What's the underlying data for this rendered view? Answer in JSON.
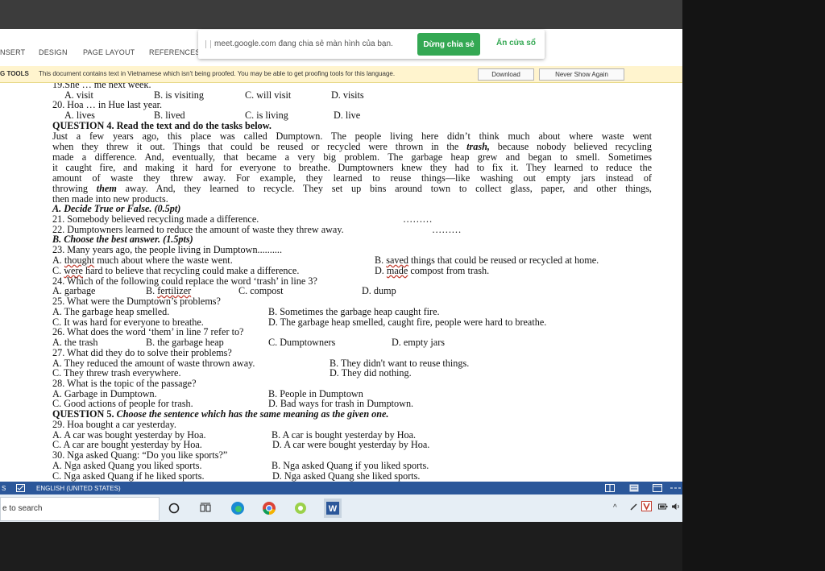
{
  "ribbon": {
    "tabs": [
      "NSERT",
      "DESIGN",
      "PAGE LAYOUT",
      "REFERENCES"
    ]
  },
  "share_bar": {
    "message": "meet.google.com đang chia sẻ màn hình của bạn.",
    "stop_button": "Dừng chia sẻ",
    "hide_button": "Ẩn cửa sổ"
  },
  "message_bar": {
    "label": "G TOOLS",
    "text": "This document contains text in Vietnamese which isn't being proofed. You may be able to get proofing tools for this language.",
    "download_button": "Download",
    "never_button": "Never Show Again"
  },
  "document": {
    "q19": "19.She … me next week.",
    "q19_a": "A. visit",
    "q19_b": "B. is visiting",
    "q19_c": "C. will visit",
    "q19_d": "D. visits",
    "q20": "20. Hoa … in Hue last year.",
    "q20_a": "A. lives",
    "q20_b": "B. lived",
    "q20_c": "C. is living",
    "q20_d": "D. live",
    "q4_title": "QUESTION 4. Read the text and do the tasks below.",
    "passage": [
      {
        "t": "Just a few years ago, this place was called Dumptown. The people living here didn’t think much about where waste went"
      },
      {
        "t": "when they threw it out. Things that could be reused or recycled were thrown in the ",
        "em": "trash,",
        "t2": " because nobody believed recycling"
      },
      {
        "t": "made a difference. And, eventually, that became a very big problem. The garbage heap grew and began to smell. Sometimes"
      },
      {
        "t": "it caught fire, and making it hard for everyone to breathe. Dumptowners knew they had to fix it. They learned to reduce the"
      },
      {
        "t": "amount of waste they threw away. For example, they learned to reuse things—like washing out empty jars instead of"
      },
      {
        "t": "throwing ",
        "em": "them",
        "t2": " away. And, they learned to recycle. They set up bins around town to collect glass, paper, and other things,"
      }
    ],
    "passage_end": "then made into new products.",
    "partA_title": "A. Decide True or False. (0.5pt)",
    "q21": "21. Somebody believed recycling made a difference.",
    "q21_blank": "………",
    "q22": "22. Dumptowners learned to reduce the amount of waste they threw away.",
    "q22_blank": "………",
    "partB_title": "B. Choose the best answer. (1.5pts)",
    "q23": "23. Many years ago, the people living in Dumptown..........",
    "q23_a_pre": "A. ",
    "q23_a_w": "thought",
    "q23_a_post": " much about where the waste went.",
    "q23_b_pre": "B. ",
    "q23_b_w": "saved",
    "q23_b_post": " things that could be reused or recycled at home.",
    "q23_c_pre": "C. ",
    "q23_c_w": "were",
    "q23_c_post": " hard to believe that recycling could make a difference.",
    "q23_d_pre": "D. ",
    "q23_d_w": "made",
    "q23_d_post": " compost from trash.",
    "q24": "24. Which of the following could replace the word ‘trash’ in line 3?",
    "q24_a": "A. garbage",
    "q24_b_pre": "B. ",
    "q24_b_w": "fertilizer",
    "q24_c": "C. compost",
    "q24_d": "D. dump",
    "q25": "25. What were the Dumptown’s problems?",
    "q25_a": "A. The garbage heap smelled.",
    "q25_b": "B. Sometimes the garbage heap caught fire.",
    "q25_c": "C. It was hard for everyone to breathe.",
    "q25_d": "D. The garbage heap smelled, caught fire, people were hard to breathe.",
    "q26": "26. What does the word ‘them’ in line 7 refer to?",
    "q26_a": "A. the trash",
    "q26_b": "B. the garbage heap",
    "q26_c": "C. Dumptowners",
    "q26_d": "D. empty jars",
    "q27": "27. What did they do to solve their problems?",
    "q27_a": "A. They reduced the amount of waste thrown away.",
    "q27_b": "B. They didn't want to reuse things.",
    "q27_c": "C. They threw trash everywhere.",
    "q27_d": "D. They did nothing.",
    "q28": "28. What is the topic of the passage?",
    "q28_a": "A. Garbage in Dumptown.",
    "q28_b": "B. People in Dumptown",
    "q28_c": "C. Good actions of people for trash.",
    "q28_d": "D. Bad ways for trash in Dumptown.",
    "q5_title_plain": "QUESTION 5. ",
    "q5_title_italic": "Choose the sentence which has the same meaning as the given one.",
    "q29": "29. Hoa bought a car yesterday.",
    "q29_a": "A. A car was bought yesterday by Hoa.",
    "q29_b": "B. A car is bought yesterday by Hoa.",
    "q29_c": "C. A car are bought yesterday by Hoa.",
    "q29_d": "D. A car were bought yesterday by Hoa.",
    "q30": "30. Nga asked Quang: “Do you like sports?”",
    "q30_a": "A. Nga asked Quang you liked sports.",
    "q30_b": "B. Nga asked Quang if you liked sports.",
    "q30_c": "C. Nga asked Quang if he liked sports.",
    "q30_d": "D. Nga asked Quang she liked sports."
  },
  "status_bar": {
    "page": "S",
    "language": "ENGLISH (UNITED STATES)"
  },
  "taskbar": {
    "search_text": "e to search"
  }
}
